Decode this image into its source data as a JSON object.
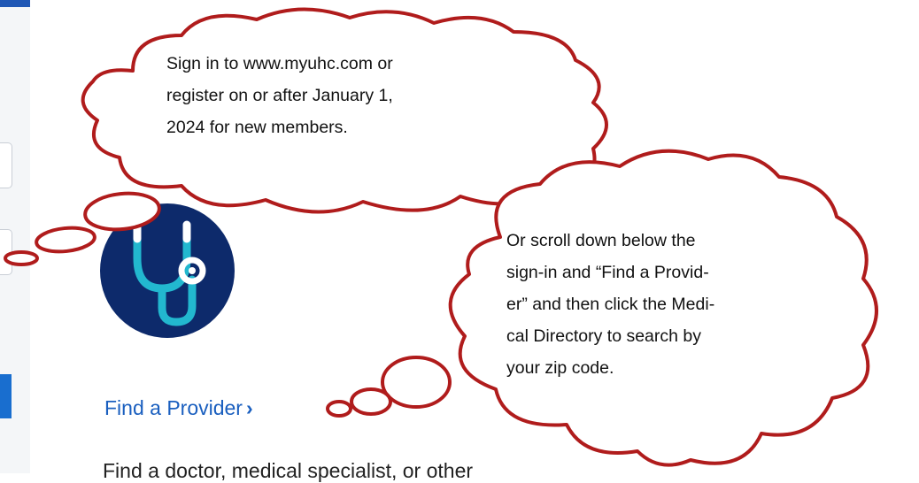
{
  "page": {
    "find_provider_label": "Find a Provider",
    "find_provider_chevron": "›",
    "cut_off_text": "Find a doctor, medical specialist, or other"
  },
  "callout_signin": {
    "lines": [
      "Sign in to www.myuhc.com or",
      "register on or after January 1,",
      "2024 for new members."
    ]
  },
  "callout_directory": {
    "lines": [
      "Or scroll down below the",
      "sign-in and “Find a Provid-",
      "er” and then click the Medi-",
      "cal Directory to search by",
      "your  zip code."
    ]
  },
  "colors": {
    "cloud_outline": "#b01c1c",
    "link_blue": "#1a5fbf",
    "icon_navy": "#0d2a6b",
    "icon_teal": "#22b8cf",
    "panel_grey": "#f4f6f8",
    "button_blue": "#196ecf"
  },
  "icons": [
    "stethoscope-icon",
    "chevron-right-icon"
  ]
}
